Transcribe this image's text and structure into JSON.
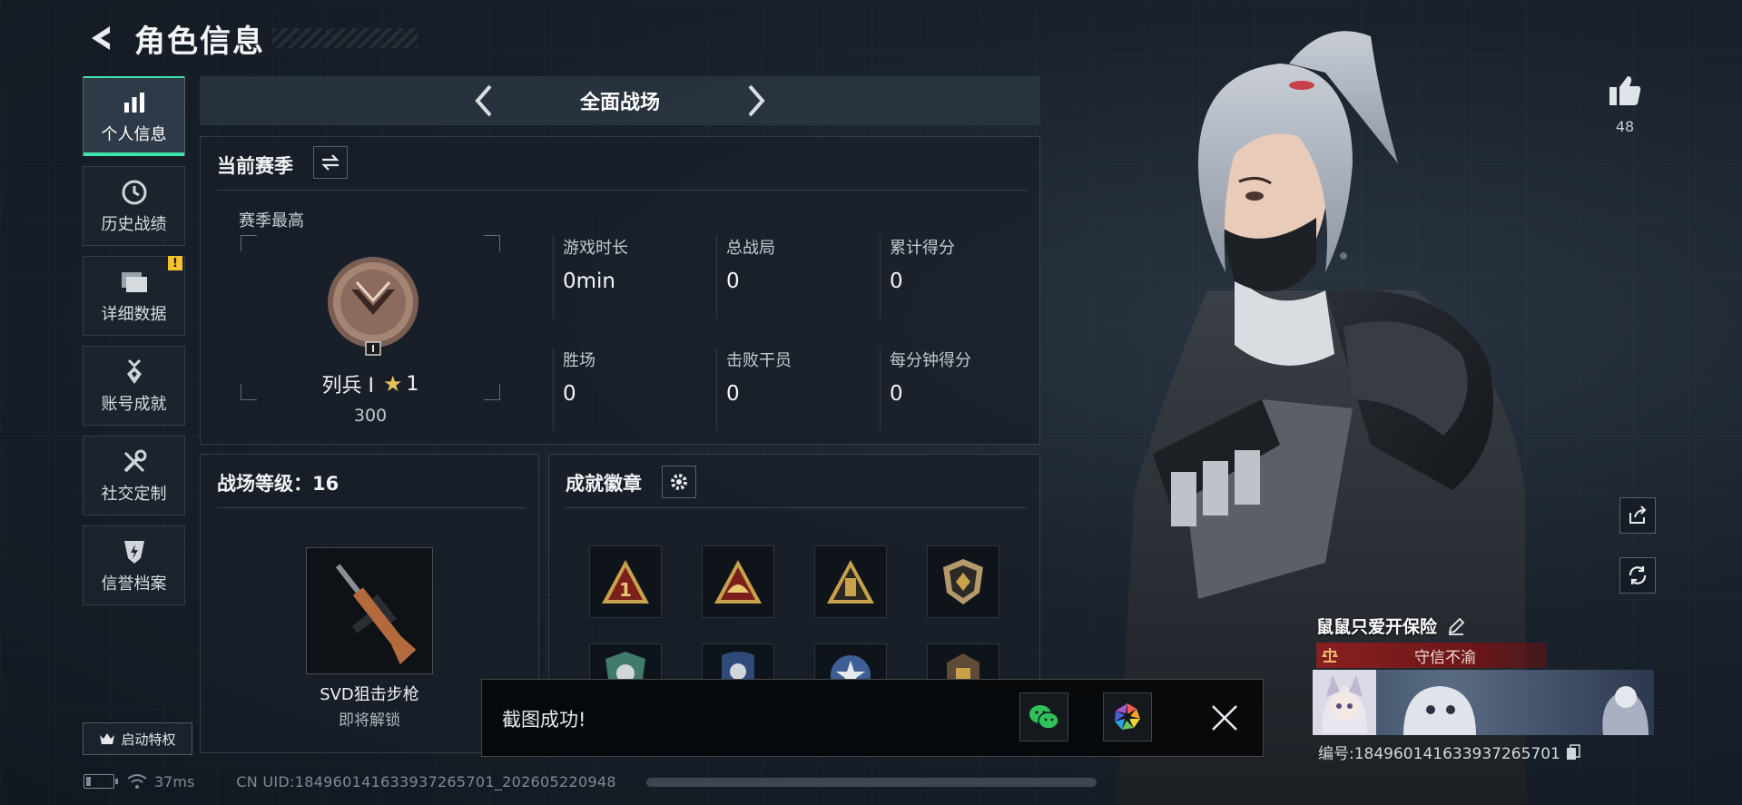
{
  "header": {
    "title": "角色信息"
  },
  "sidebar": {
    "items": [
      {
        "label": "个人信息",
        "icon": "bar-chart-icon",
        "active": true
      },
      {
        "label": "历史战绩",
        "icon": "clock-icon"
      },
      {
        "label": "详细数据",
        "icon": "folder-icon",
        "alert": "!"
      },
      {
        "label": "账号成就",
        "icon": "medal-icon"
      },
      {
        "label": "社交定制",
        "icon": "tools-icon"
      },
      {
        "label": "信誉档案",
        "icon": "shield-bolt-icon"
      }
    ],
    "launch_label": "启动特权"
  },
  "mode_bar": {
    "label": "全面战场"
  },
  "season": {
    "heading": "当前赛季",
    "best_label": "赛季最高",
    "rank_name": "列兵 Ⅰ",
    "rank_stars": "1",
    "rank_points": "300",
    "stats": [
      {
        "label": "游戏时长",
        "value": "0min"
      },
      {
        "label": "总战局",
        "value": "0"
      },
      {
        "label": "累计得分",
        "value": "0"
      },
      {
        "label": "胜场",
        "value": "0"
      },
      {
        "label": "击败干员",
        "value": "0"
      },
      {
        "label": "每分钟得分",
        "value": "0"
      }
    ]
  },
  "battlefield_level": {
    "heading": "战场等级：16",
    "weapon_name": "SVD狙击步枪",
    "weapon_status": "即将解锁"
  },
  "achievements": {
    "heading": "成就徽章"
  },
  "toast": {
    "text": "截图成功!"
  },
  "status_bar": {
    "ping": "37ms",
    "uid": "CN UID:18496014163393726570­1_202605220948"
  },
  "player": {
    "likes": "48",
    "name": "鼠鼠只爱开保险",
    "credit": "守信不渝",
    "id": "编号:18496014163393726570­1"
  },
  "colors": {
    "accent": "#3ee3a8",
    "alert": "#f2c230",
    "credit_red": "#8a1f22",
    "badge_gold": "#c8a24a"
  }
}
